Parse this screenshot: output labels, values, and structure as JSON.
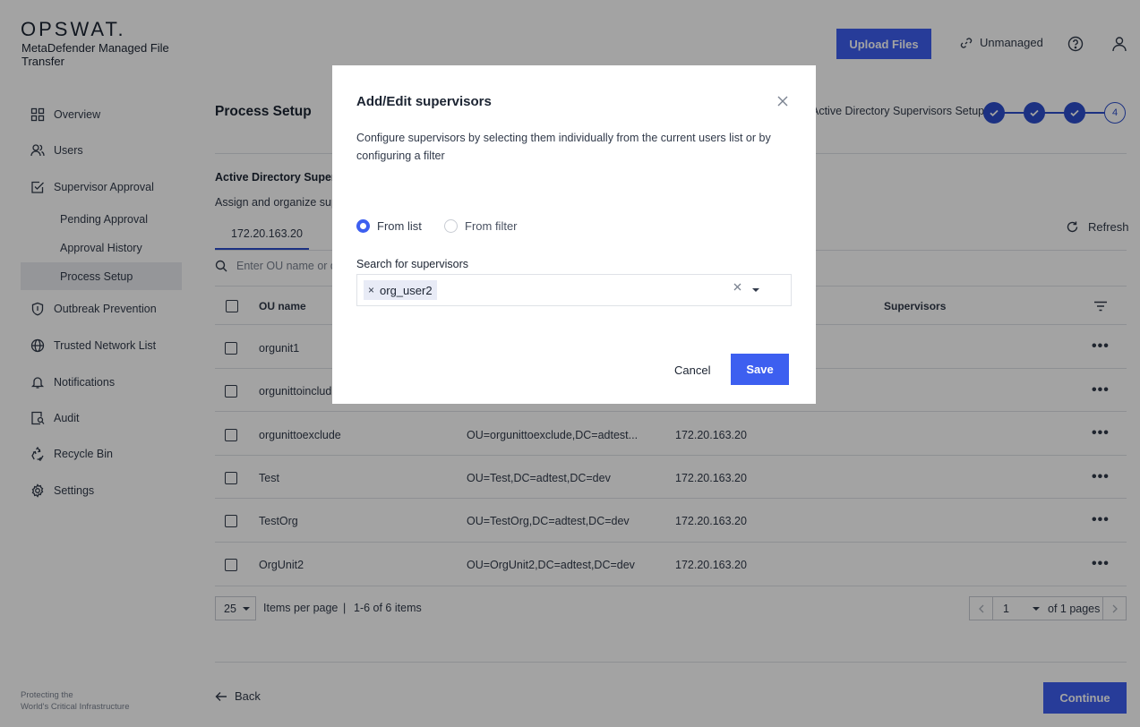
{
  "brand": {
    "logo": "OPSWAT.",
    "product": "MetaDefender Managed File Transfer",
    "footer_line1": "Protecting the",
    "footer_line2": "World's Critical Infrastructure"
  },
  "sidebar": {
    "items": [
      {
        "label": "Overview",
        "icon": "grid-icon"
      },
      {
        "label": "Users",
        "icon": "users-icon"
      },
      {
        "label": "Supervisor Approval",
        "icon": "checkbox-edit-icon"
      },
      {
        "label": "Outbreak Prevention",
        "icon": "shield-icon"
      },
      {
        "label": "Trusted Network List",
        "icon": "globe-icon"
      },
      {
        "label": "Notifications",
        "icon": "bell-icon"
      },
      {
        "label": "Audit",
        "icon": "audit-icon"
      },
      {
        "label": "Recycle Bin",
        "icon": "recycle-icon"
      },
      {
        "label": "Settings",
        "icon": "gear-icon"
      }
    ],
    "sub_items": [
      "Pending Approval",
      "Approval History",
      "Process Setup"
    ],
    "active_sub": "Process Setup"
  },
  "header": {
    "upload_label": "Upload Files",
    "unmanaged_label": "Unmanaged"
  },
  "main": {
    "title": "Process Setup",
    "stepper_label": "Active Directory Supervisors Setup",
    "step_4": "4",
    "section_title": "Active Directory Supervi",
    "section_sub": "Assign and organize sup",
    "tab_label": "172.20.163.20",
    "refresh_label": "Refresh",
    "search_placeholder": "Enter OU name or di",
    "columns": {
      "ou_name": "OU name",
      "supervisors": "Supervisors"
    },
    "rows": [
      {
        "ou": "orgunit1",
        "dn": "",
        "server": ""
      },
      {
        "ou": "orgunittoinclud",
        "dn": "",
        "server": ""
      },
      {
        "ou": "orgunittoexclude",
        "dn": "OU=orgunittoexclude,DC=adtest...",
        "server": "172.20.163.20"
      },
      {
        "ou": "Test",
        "dn": "OU=Test,DC=adtest,DC=dev",
        "server": "172.20.163.20"
      },
      {
        "ou": "TestOrg",
        "dn": "OU=TestOrg,DC=adtest,DC=dev",
        "server": "172.20.163.20"
      },
      {
        "ou": "OrgUnit2",
        "dn": "OU=OrgUnit2,DC=adtest,DC=dev",
        "server": "172.20.163.20"
      }
    ],
    "row_actions": "•••",
    "pagination": {
      "per_page": "25",
      "per_page_label": "Items per page",
      "separator": "|",
      "range": "1-6 of 6 items",
      "page": "1",
      "of_pages": "of 1 pages"
    },
    "back_label": "Back",
    "continue_label": "Continue"
  },
  "modal": {
    "title": "Add/Edit supervisors",
    "description": "Configure supervisors by selecting them individually from the current users list or by configuring a filter",
    "radio_list": "From list",
    "radio_filter": "From filter",
    "selected_mode": "From list",
    "field_label": "Search for supervisors",
    "chips": [
      "org_user2"
    ],
    "cancel_label": "Cancel",
    "save_label": "Save"
  },
  "colors": {
    "accent": "#3d5ff0",
    "step": "#2c4ecb",
    "overlay": "rgba(0,0,0,0.36)"
  }
}
